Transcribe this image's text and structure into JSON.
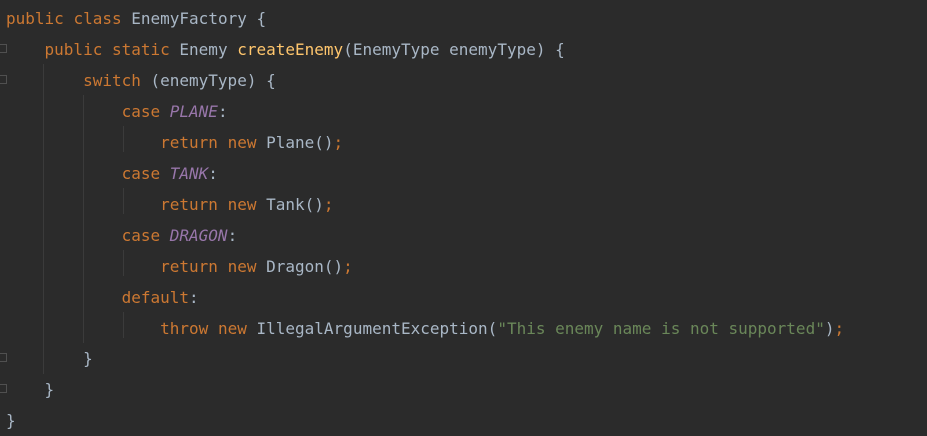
{
  "code": {
    "l1": {
      "kw_public": "public",
      "kw_class": "class",
      "name": "EnemyFactory",
      "brace": " {"
    },
    "l2": {
      "kw_public": "public",
      "kw_static": "static",
      "ret": "Enemy",
      "method": "createEnemy",
      "params": "(EnemyType enemyType) {"
    },
    "l3": {
      "kw_switch": "switch",
      "rest": " (enemyType) {"
    },
    "l4": {
      "kw_case": "case",
      "const": "PLANE",
      "colon": ":"
    },
    "l5": {
      "kw_return": "return",
      "kw_new": "new",
      "call": "Plane()",
      "semi": ";"
    },
    "l6": {
      "kw_case": "case",
      "const": "TANK",
      "colon": ":"
    },
    "l7": {
      "kw_return": "return",
      "kw_new": "new",
      "call": "Tank()",
      "semi": ";"
    },
    "l8": {
      "kw_case": "case",
      "const": "DRAGON",
      "colon": ":"
    },
    "l9": {
      "kw_return": "return",
      "kw_new": "new",
      "call": "Dragon()",
      "semi": ";"
    },
    "l10": {
      "kw_default": "default",
      "colon": ":"
    },
    "l11": {
      "kw_throw": "throw",
      "kw_new": "new",
      "call_open": "IllegalArgumentException(",
      "str": "\"This enemy name is not supported\"",
      "close": ")",
      "semi": ";"
    },
    "l12": {
      "brace": "}"
    },
    "l13": {
      "brace": "}"
    },
    "l14": {
      "brace": "}"
    }
  },
  "colors": {
    "background": "#2b2b2b",
    "keyword": "#cc7832",
    "plain": "#a9b7c6",
    "method": "#ffc66d",
    "constant": "#9876aa",
    "string": "#6a8759"
  }
}
